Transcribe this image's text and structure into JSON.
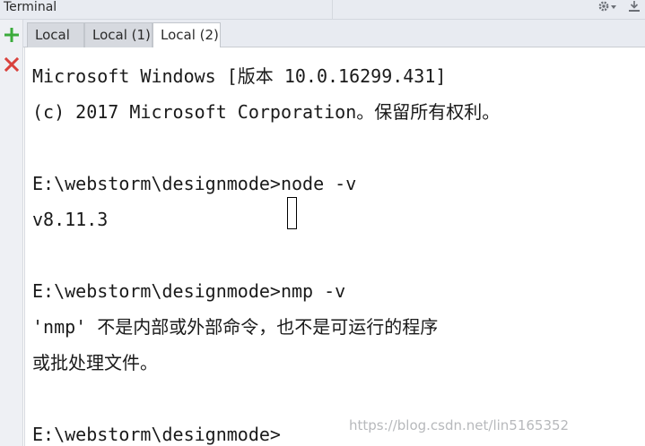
{
  "window": {
    "title": "Terminal"
  },
  "toolbar": {
    "settings_icon": "gear-icon",
    "hide_icon": "minimize-icon"
  },
  "sidebar": {
    "new_session_icon": "plus-icon",
    "close_session_icon": "close-icon"
  },
  "tabs": [
    {
      "label": "Local",
      "active": false
    },
    {
      "label": "Local (1)",
      "active": false
    },
    {
      "label": "Local (2)",
      "active": true
    }
  ],
  "terminal": {
    "lines": [
      "Microsoft Windows [版本 10.0.16299.431]",
      "(c) 2017 Microsoft Corporation。保留所有权利。",
      "",
      "E:\\webstorm\\designmode>node -v",
      "v8.11.3",
      "",
      "E:\\webstorm\\designmode>nmp -v",
      "'nmp' 不是内部或外部命令，也不是可运行的程序",
      "或批处理文件。",
      "",
      "E:\\webstorm\\designmode>"
    ],
    "watermark": "https://blog.csdn.net/lin5165352"
  },
  "colors": {
    "add": "#3bab3b",
    "close": "#d9413c",
    "background": "#ffffff",
    "chrome": "#e8ebf1"
  }
}
